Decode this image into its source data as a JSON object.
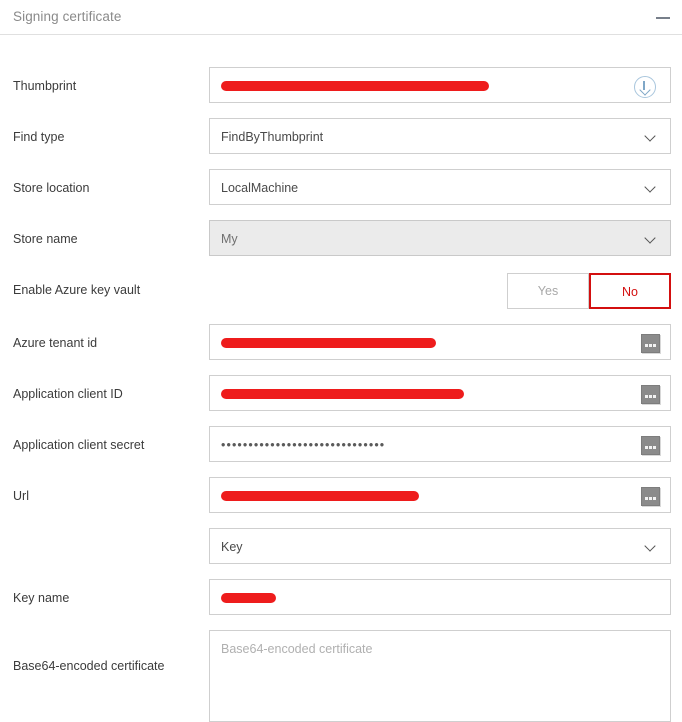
{
  "panel": {
    "title": "Signing certificate",
    "collapse_icon": "minus-icon"
  },
  "colors": {
    "accent_red": "#d30f0f",
    "redaction_red": "#ee1c1c",
    "border": "#cfcfcf",
    "disabled_bg": "#ebebeb",
    "label_text": "#3b3b3b",
    "title_text": "#8a8a8a",
    "placeholder_text": "#b0b0b0",
    "download_icon": "#7fa7c7"
  },
  "fields": {
    "thumbprint": {
      "label": "Thumbprint",
      "value": "",
      "redacted": true,
      "trailing_icon": "download-circle-icon"
    },
    "find_type": {
      "label": "Find type",
      "value": "FindByThumbprint",
      "trailing_icon": "chevron-down-icon"
    },
    "store_location": {
      "label": "Store location",
      "value": "LocalMachine",
      "trailing_icon": "chevron-down-icon"
    },
    "store_name": {
      "label": "Store name",
      "value": "My",
      "disabled": true,
      "trailing_icon": "chevron-down-icon"
    },
    "enable_azure_key_vault": {
      "label": "Enable Azure key vault",
      "options": [
        "Yes",
        "No"
      ],
      "selected": "No"
    },
    "azure_tenant_id": {
      "label": "Azure tenant id",
      "value": "",
      "redacted": true,
      "trailing_icon": "ellipsis-button"
    },
    "application_client_id": {
      "label": "Application client ID",
      "value": "",
      "redacted": true,
      "trailing_icon": "ellipsis-button"
    },
    "application_client_secret": {
      "label": "Application client secret",
      "value": "••••••••••••••••••••••••••••••",
      "masked": true,
      "trailing_icon": "ellipsis-button"
    },
    "url": {
      "label": "Url",
      "value": "",
      "redacted": true,
      "trailing_icon": "ellipsis-button"
    },
    "secret_kind": {
      "label": "",
      "value": "Key",
      "trailing_icon": "chevron-down-icon"
    },
    "key_name": {
      "label": "Key name",
      "value": "",
      "redacted": true
    },
    "base64_certificate": {
      "label": "Base64-encoded certificate",
      "value": "",
      "placeholder": "Base64-encoded certificate"
    }
  }
}
